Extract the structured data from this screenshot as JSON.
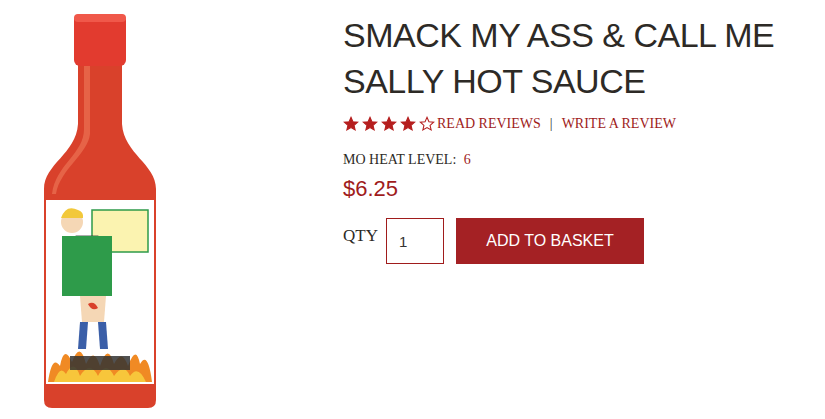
{
  "product": {
    "title": "SMACK MY ASS & CALL ME SALLY HOT SAUCE",
    "stars": 4,
    "review_links": [
      "READ REVIEWS",
      "WRITE A REVIEW"
    ],
    "separator": "|",
    "heat": {
      "label": "MO HEAT LEVEL:",
      "value": "6"
    },
    "price": "$6.25",
    "quantity": {
      "label": "QTY",
      "value": "1"
    },
    "button": "ADD TO BASKET"
  }
}
